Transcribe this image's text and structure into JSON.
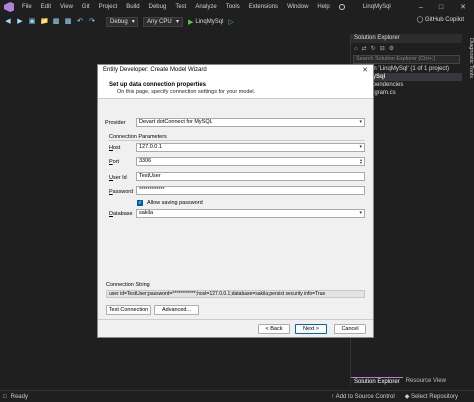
{
  "titlebar": {
    "menu": [
      "File",
      "Edit",
      "View",
      "Git",
      "Project",
      "Build",
      "Debug",
      "Test",
      "Analyze",
      "Tools",
      "Extensions",
      "Window",
      "Help"
    ],
    "app_title": "LinqMySql"
  },
  "toolbar": {
    "config": "Debug",
    "platform": "Any CPU",
    "start_target": "LinqMySql",
    "copilot": "GitHub Copilot"
  },
  "solution_explorer": {
    "title": "Solution Explorer",
    "search_placeholder": "Search Solution Explorer (Ctrl+;)",
    "items": [
      "Solution 'LinqMySql' (1 of 1 project)",
      "LinqMySql",
      "Dependencies",
      "Program.cs"
    ],
    "tabs": [
      "Solution Explorer",
      "Resource View"
    ]
  },
  "side_tab": "Diagnostic Tools",
  "statusbar": {
    "left": "Ready",
    "source_control": "Add to Source Control",
    "repository": "Select Repository"
  },
  "dialog": {
    "title": "Entity Developer: Create Model Wizard",
    "header_title": "Set up data connection properties",
    "header_subtitle": "On this page, specify connection settings for your model.",
    "provider_label": "Provider",
    "provider_value": "Devart dotConnect for MySQL",
    "conn_params_label": "Connection Parameters",
    "host_label": "Host",
    "host_value": "127.0.0.1",
    "port_label": "Port",
    "port_value": "3306",
    "userid_label": "User Id",
    "userid_value": "TestUser",
    "password_label": "Password",
    "password_value": "************",
    "allow_saving_label": "Allow saving password",
    "allow_saving_checked": true,
    "database_label": "Database",
    "database_value": "sakila",
    "connstr_label": "Connection String",
    "connstr_value": "user id=TestUser;password=************;host=127.0.0.1;database=sakila;persist security info=True",
    "test_connection": "Test Connection",
    "advanced": "Advanced...",
    "back": "< Back",
    "next": "Next >",
    "cancel": "Cancel"
  }
}
